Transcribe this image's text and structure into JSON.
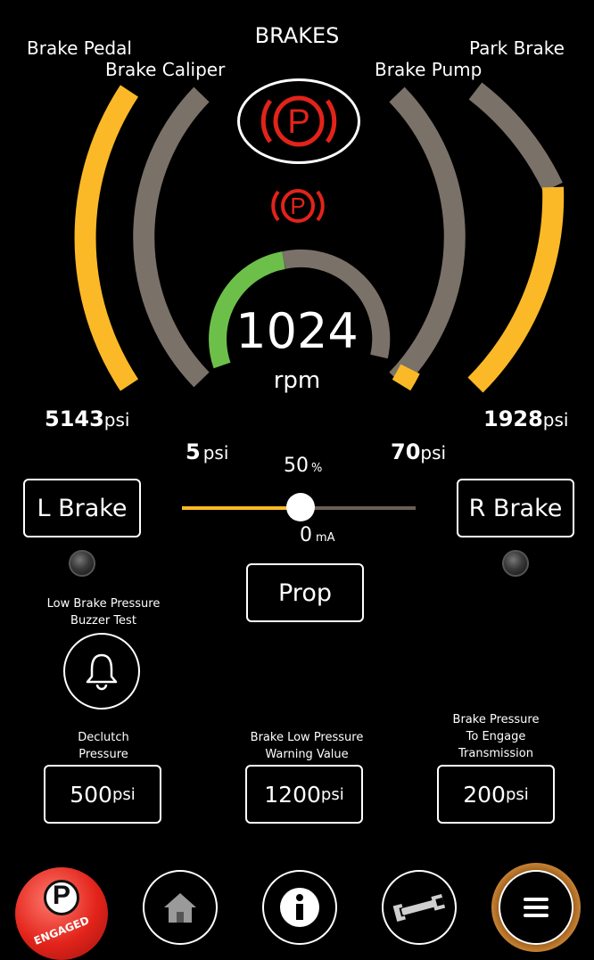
{
  "title": "BRAKES",
  "gauges": {
    "brake_pedal": {
      "label": "Brake Pedal",
      "value": "5143",
      "unit": "psi",
      "fill_fraction": 1.0
    },
    "brake_caliper": {
      "label": "Brake Caliper",
      "value": "5",
      "unit": "psi",
      "fill_fraction": 0.0
    },
    "brake_pump": {
      "label": "Brake Pump",
      "value": "70",
      "unit": "psi",
      "fill_fraction": 0.03
    },
    "park_brake": {
      "label": "Park Brake",
      "value": "1928",
      "unit": "psi",
      "fill_fraction": 0.7
    },
    "rpm": {
      "value": "1024",
      "unit": "rpm",
      "fill_fraction": 0.35
    }
  },
  "slider": {
    "percent_value": "50",
    "percent_unit": "%",
    "current_value": "0",
    "current_unit": "mA",
    "position_fraction": 0.5
  },
  "buttons": {
    "l_brake": "L Brake",
    "r_brake": "R Brake",
    "prop": "Prop"
  },
  "buzzer_test": {
    "label_line1": "Low Brake Pressure",
    "label_line2": "Buzzer Test"
  },
  "settings": [
    {
      "label_line1": "Declutch",
      "label_line2": "Pressure",
      "value": "500",
      "unit": "psi"
    },
    {
      "label_line1": "Brake Low Pressure",
      "label_line2": "Warning Value",
      "value": "1200",
      "unit": "psi"
    },
    {
      "label_line1": "Brake Pressure",
      "label_line2": "To Engage",
      "label_line3": "Transmission",
      "value": "200",
      "unit": "psi"
    }
  ],
  "nav": {
    "park_status": "ENGAGED",
    "park_letter": "P"
  },
  "colors": {
    "accent_yellow": "#fbb927",
    "track_gray": "#7a7168",
    "rpm_green": "#6cc04a",
    "warning_red": "#e2231a",
    "menu_ring": "#a8661e"
  },
  "icons": {
    "park_warning": "parking-brake-icon",
    "bell": "bell-icon",
    "home": "home-icon",
    "info": "info-icon",
    "wrench": "wrench-icon",
    "menu": "menu-icon"
  }
}
